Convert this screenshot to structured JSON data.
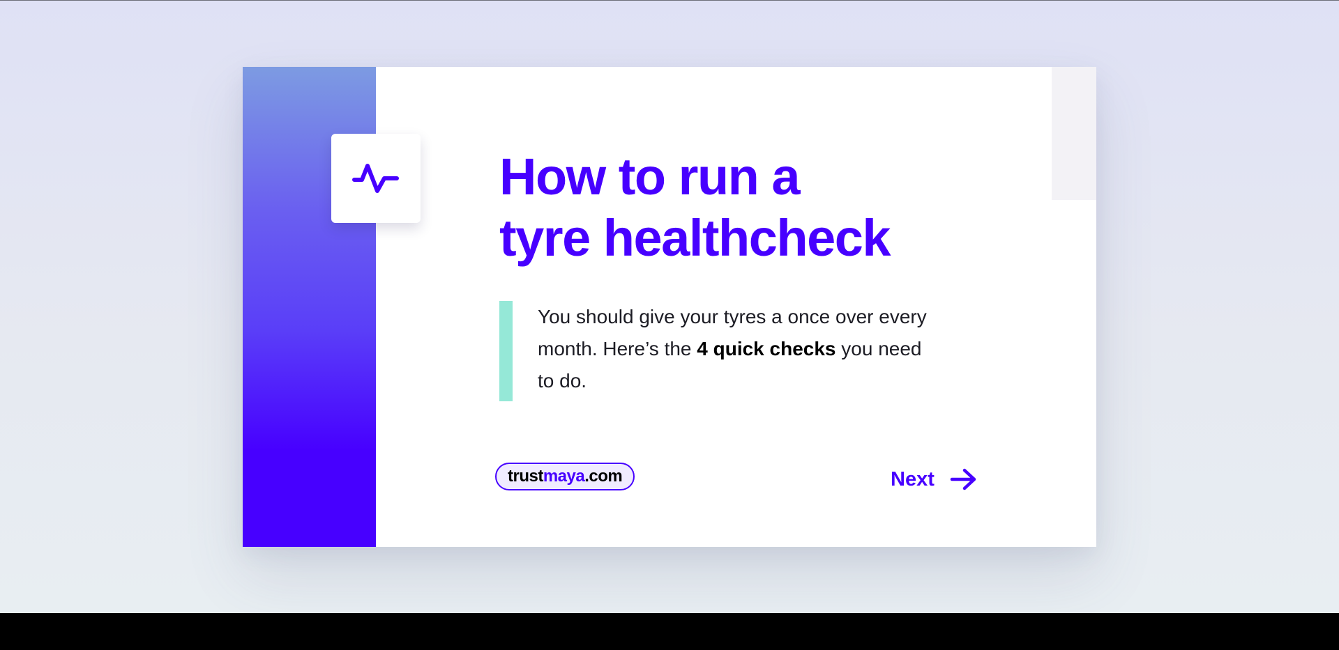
{
  "card": {
    "title_line1": "How to run a",
    "title_line2": "tyre healthcheck",
    "description": {
      "before": "You should give your tyres a once over every month. Here’s the ",
      "bold": "4 quick checks",
      "after": " you need to do."
    },
    "brand": {
      "part1": "trust",
      "part2": "maya",
      "part3": ".com"
    },
    "next_label": "Next"
  },
  "icons": {
    "tile_icon": "pulse-icon",
    "next_icon": "arrow-right-icon"
  },
  "colors": {
    "accent": "#4700ff",
    "quote_bar": "#95e8d7",
    "pill_bg": "#f0ecff",
    "background_top": "#dfe1f5",
    "background_bottom": "#e8eef2"
  }
}
